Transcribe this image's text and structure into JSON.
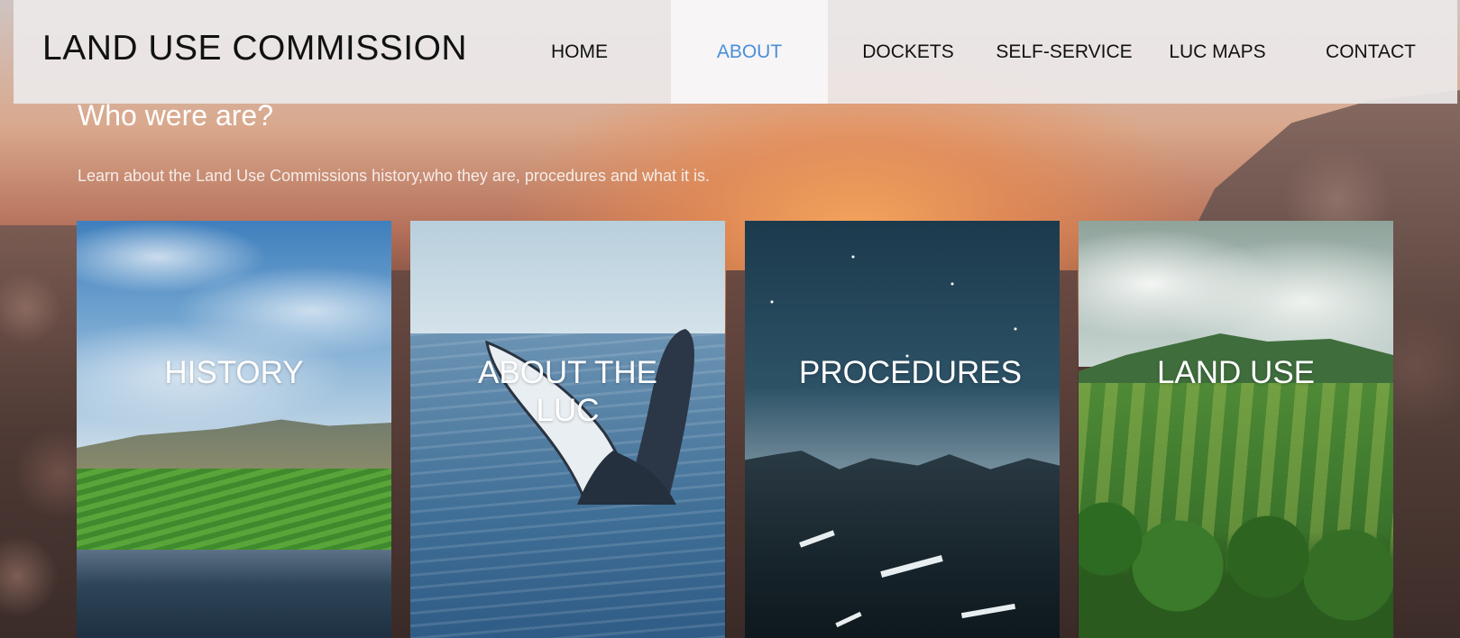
{
  "brand": {
    "title": "LAND USE COMMISSION"
  },
  "nav": {
    "items": [
      {
        "label": "HOME"
      },
      {
        "label": "ABOUT",
        "active": true
      },
      {
        "label": "DOCKETS"
      },
      {
        "label": "SELF-SERVICE"
      },
      {
        "label": "LUC MAPS"
      },
      {
        "label": "CONTACT"
      }
    ]
  },
  "intro": {
    "heading": "Who were are?",
    "text": "Learn about the Land Use Commissions history,who they are, procedures and what it is."
  },
  "cards": [
    {
      "label": "HISTORY"
    },
    {
      "label": "ABOUT THE LUC"
    },
    {
      "label": "PROCEDURES"
    },
    {
      "label": "LAND USE"
    }
  ],
  "colors": {
    "active_nav": "#4a90d9",
    "header_bg": "#ece8e8"
  }
}
